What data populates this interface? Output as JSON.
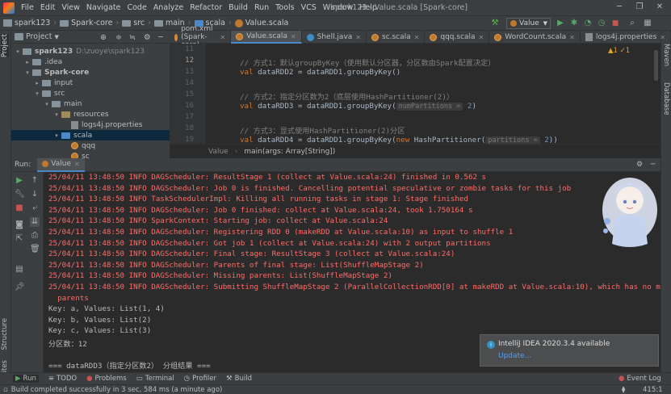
{
  "menubar": {
    "items": [
      "File",
      "Edit",
      "View",
      "Navigate",
      "Code",
      "Analyze",
      "Refactor",
      "Build",
      "Run",
      "Tools",
      "VCS",
      "Window",
      "Help"
    ],
    "title": "spark123 - Value.scala [Spark-core]"
  },
  "navbar": {
    "crumbs": [
      "spark123",
      "Spark-core",
      "src",
      "main",
      "scala",
      "Value.scala"
    ],
    "run_config": "Value"
  },
  "project": {
    "header": "Project",
    "tree": [
      {
        "label": "spark123",
        "extra": "D:\\zuoye\\spark123",
        "indent": 0,
        "arrow": "▾",
        "icon": "folder"
      },
      {
        "label": ".idea",
        "extra": "",
        "indent": 1,
        "arrow": "▸",
        "icon": "folder"
      },
      {
        "label": "Spark-core",
        "extra": "",
        "indent": 1,
        "arrow": "▾",
        "icon": "folder"
      },
      {
        "label": "input",
        "extra": "",
        "indent": 2,
        "arrow": "▸",
        "icon": "folder"
      },
      {
        "label": "src",
        "extra": "",
        "indent": 2,
        "arrow": "▾",
        "icon": "folder"
      },
      {
        "label": "main",
        "extra": "",
        "indent": 3,
        "arrow": "▾",
        "icon": "folder"
      },
      {
        "label": "resources",
        "extra": "",
        "indent": 4,
        "arrow": "▾",
        "icon": "folder-yellow"
      },
      {
        "label": "logs4j.properties",
        "extra": "",
        "indent": 5,
        "arrow": "",
        "icon": "props"
      },
      {
        "label": "scala",
        "extra": "",
        "indent": 4,
        "arrow": "▾",
        "icon": "folder-blue"
      },
      {
        "label": "qqq",
        "extra": "",
        "indent": 5,
        "arrow": "",
        "icon": "scala"
      },
      {
        "label": "sc",
        "extra": "",
        "indent": 5,
        "arrow": "",
        "icon": "scala"
      }
    ]
  },
  "tabs": [
    {
      "label": "pom.xml (Spark-core)",
      "icon": "xml",
      "active": false
    },
    {
      "label": "Value.scala",
      "icon": "scala",
      "active": true
    },
    {
      "label": "Shell.java",
      "icon": "java",
      "active": false
    },
    {
      "label": "sc.scala",
      "icon": "scala",
      "active": false
    },
    {
      "label": "qqq.scala",
      "icon": "scala",
      "active": false
    },
    {
      "label": "WordCount.scala",
      "icon": "scala",
      "active": false
    },
    {
      "label": "logs4j.properties",
      "icon": "props",
      "active": false
    }
  ],
  "editor": {
    "line_numbers": [
      "11",
      "12",
      "13",
      "14",
      "15",
      "16",
      "17",
      "18",
      "19"
    ],
    "current_line": "12",
    "inspection": "▲1 ✓1",
    "lines": [
      {
        "comment": "",
        "parts": []
      },
      {
        "comment": "// 方式1：默认groupByKey（使用默认分区器，分区数由Spark配置决定）",
        "parts": []
      },
      {
        "comment": "",
        "kw": "val",
        "rest": " dataRDD2 = dataRDD1.groupByKey()"
      },
      {
        "comment": "",
        "parts": []
      },
      {
        "comment": "// 方式2：指定分区数为2（底层使用HashPartitioner(2)）",
        "parts": []
      },
      {
        "comment": "",
        "kw": "val",
        "rest": " dataRDD3 = dataRDD1.groupByKey(",
        "hint": "numPartitions =",
        "num": " 2",
        "tail": ")"
      },
      {
        "comment": "",
        "parts": []
      },
      {
        "comment": "// 方式3：显式使用HashPartitioner(2)分区",
        "parts": []
      },
      {
        "comment": "",
        "kw": "val",
        "rest": " dataRDD4 = dataRDD1.groupByKey(",
        "kw2": "new",
        "rest2": " HashPartitioner(",
        "hint": "partitions =",
        "num": " 2",
        "tail": "))"
      }
    ],
    "breadcrumb_object": "Value",
    "breadcrumb_method": "main(args: Array[String])"
  },
  "run": {
    "label": "Run:",
    "tab": "Value",
    "console": [
      {
        "cls": "red",
        "text": "25/04/11 13:48:50 INFO DAGScheduler: ResultStage 1 (collect at Value.scala:24) finished in 0.562 s"
      },
      {
        "cls": "red",
        "text": "25/04/11 13:48:50 INFO DAGScheduler: Job 0 is finished. Cancelling potential speculative or zombie tasks for this job"
      },
      {
        "cls": "red",
        "text": "25/04/11 13:48:50 INFO TaskSchedulerImpl: Killing all running tasks in stage 1: Stage finished"
      },
      {
        "cls": "red",
        "text": "25/04/11 13:48:50 INFO DAGScheduler: Job 0 finished: collect at Value.scala:24, took 1.750164 s"
      },
      {
        "cls": "red",
        "text": "25/04/11 13:48:50 INFO SparkContext: Starting job: collect at Value.scala:24"
      },
      {
        "cls": "red",
        "text": "25/04/11 13:48:50 INFO DAGScheduler: Registering RDD 0 (makeRDD at Value.scala:10) as input to shuffle 1"
      },
      {
        "cls": "red",
        "text": "25/04/11 13:48:50 INFO DAGScheduler: Got job 1 (collect at Value.scala:24) with 2 output partitions"
      },
      {
        "cls": "red",
        "text": "25/04/11 13:48:50 INFO DAGScheduler: Final stage: ResultStage 3 (collect at Value.scala:24)"
      },
      {
        "cls": "red",
        "text": "25/04/11 13:48:50 INFO DAGScheduler: Parents of final stage: List(ShuffleMapStage 2)"
      },
      {
        "cls": "red",
        "text": "25/04/11 13:48:50 INFO DAGScheduler: Missing parents: List(ShuffleMapStage 2)"
      },
      {
        "cls": "red",
        "text": "25/04/11 13:48:50 INFO DAGScheduler: Submitting ShuffleMapStage 2 (ParallelCollectionRDD[0] at makeRDD at Value.scala:10), which has no missing"
      },
      {
        "cls": "red",
        "text": "  parents"
      },
      {
        "cls": "out",
        "text": "Key: a, Values: List(1, 4)"
      },
      {
        "cls": "out",
        "text": "Key: b, Values: List(2)"
      },
      {
        "cls": "out",
        "text": "Key: c, Values: List(3)"
      },
      {
        "cls": "out",
        "text": "分区数：12"
      },
      {
        "cls": "out",
        "text": ""
      },
      {
        "cls": "out",
        "text": "=== dataRDD3（指定分区数2） 分组结果 ==="
      }
    ]
  },
  "notification": {
    "title": "IntelliJ IDEA 2020.3.4 available",
    "link": "Update..."
  },
  "left_strip": {
    "project": "Project",
    "structure": "Structure",
    "favorites": "Favorites"
  },
  "right_strip": {
    "maven": "Maven",
    "database": "Database"
  },
  "bottom_tabs": [
    "Run",
    "TODO",
    "Problems",
    "Terminal",
    "Profiler",
    "Build"
  ],
  "event_log": "Event Log",
  "status": {
    "message": "Build completed successfully in 3 sec, 584 ms (a minute ago)",
    "position": "415:1"
  },
  "colors": {
    "accent": "#4a88c7",
    "error_text": "#ff6b68",
    "comment": "#808080",
    "keyword": "#cc7832"
  }
}
